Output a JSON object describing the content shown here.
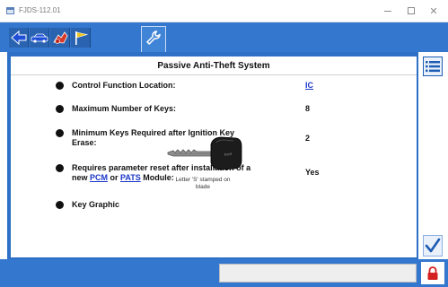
{
  "window": {
    "title": "FJDS-112.01"
  },
  "toolbar": {
    "buttons": [
      {
        "icon": "back-arrow-icon"
      },
      {
        "icon": "vehicle-icon"
      },
      {
        "icon": "toolbox-icon"
      },
      {
        "icon": "flag-icon"
      }
    ],
    "active_tab_icon": "wrench-icon"
  },
  "panel": {
    "title": "Passive Anti-Theft System",
    "rows": [
      {
        "label": "Control Function Location:",
        "value": "IC"
      },
      {
        "label": "Maximum Number of Keys:",
        "value": "8"
      },
      {
        "label_line1": "Minimum Keys Required after Ignition Key",
        "label_line2": "Erase:",
        "value": "2"
      },
      {
        "label_line1": "Requires parameter reset after installation of a",
        "label_prefix": "new ",
        "link1": "PCM",
        "label_mid": " or ",
        "link2": "PATS",
        "label_suffix": " Module:",
        "value": "Yes"
      },
      {
        "label": "Key Graphic"
      }
    ],
    "key_caption_line1": "Letter 'S' stamped on",
    "key_caption_line2": "blade"
  },
  "colors": {
    "accent": "#3477cf",
    "link": "#1a36c9",
    "lock": "#d42020"
  }
}
